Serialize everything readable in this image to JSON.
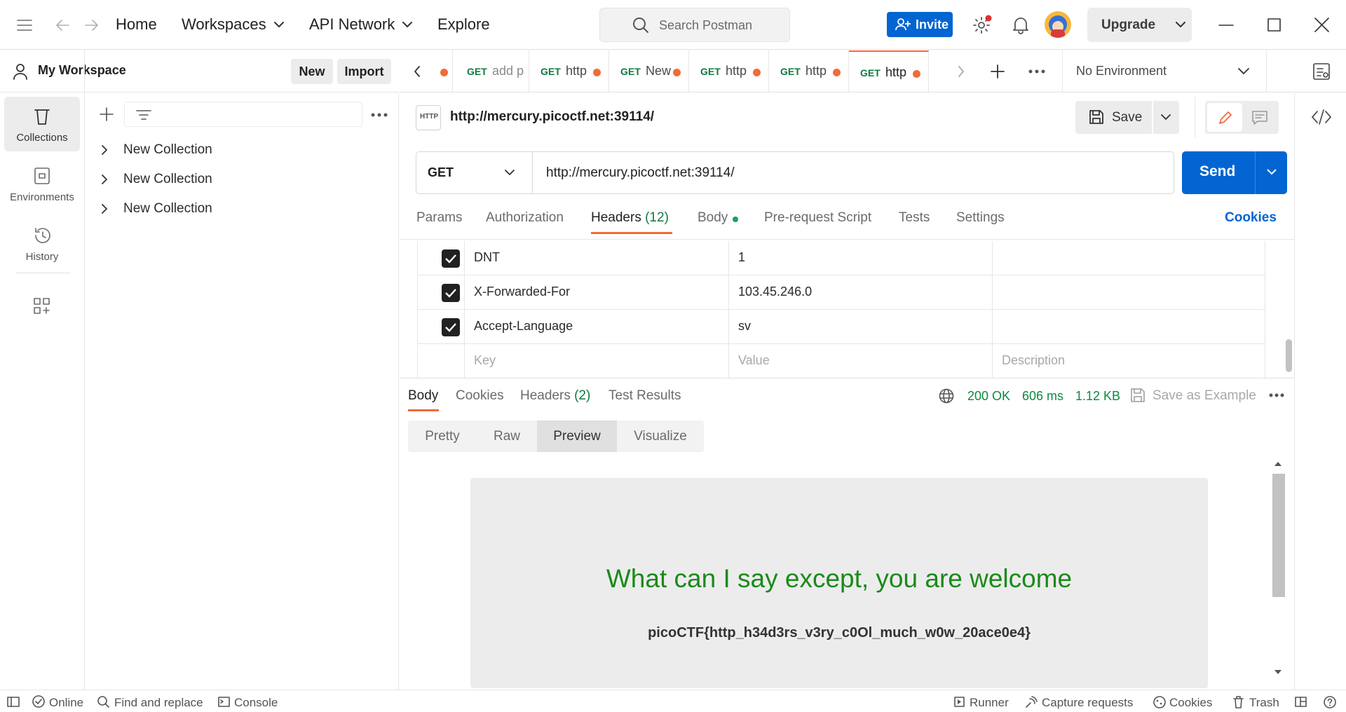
{
  "topbar": {
    "home": "Home",
    "workspaces": "Workspaces",
    "api_network": "API Network",
    "explore": "Explore",
    "search_placeholder": "Search Postman",
    "invite": "Invite",
    "upgrade": "Upgrade"
  },
  "workspace": {
    "name": "My Workspace",
    "new_label": "New",
    "import_label": "Import"
  },
  "rail": {
    "collections": "Collections",
    "environments": "Environments",
    "history": "History"
  },
  "collections": [
    "New Collection",
    "New Collection",
    "New Collection"
  ],
  "tabs": [
    {
      "method": "GET",
      "name": "add pa"
    },
    {
      "method": "GET",
      "name": "http"
    },
    {
      "method": "GET",
      "name": "New"
    },
    {
      "method": "GET",
      "name": "http"
    },
    {
      "method": "GET",
      "name": "http"
    },
    {
      "method": "GET",
      "name": "http"
    }
  ],
  "environment": "No Environment",
  "request": {
    "title": "http://mercury.picoctf.net:39114/",
    "save": "Save",
    "method": "GET",
    "url": "http://mercury.picoctf.net:39114/",
    "send": "Send"
  },
  "request_tabs": {
    "params": "Params",
    "authorization": "Authorization",
    "headers": "Headers",
    "headers_count": "(12)",
    "body": "Body",
    "prerequest": "Pre-request Script",
    "tests": "Tests",
    "settings": "Settings",
    "cookies": "Cookies"
  },
  "headers": [
    {
      "key": "DNT",
      "value": "1"
    },
    {
      "key": "X-Forwarded-For",
      "value": "103.45.246.0"
    },
    {
      "key": "Accept-Language",
      "value": "sv"
    }
  ],
  "headers_placeholder": {
    "key": "Key",
    "value": "Value",
    "description": "Description"
  },
  "response": {
    "tabs": {
      "body": "Body",
      "cookies": "Cookies",
      "headers": "Headers",
      "headers_count": "(2)",
      "test_results": "Test Results"
    },
    "status": "200 OK",
    "time": "606 ms",
    "size": "1.12 KB",
    "save_example": "Save as Example",
    "views": [
      "Pretty",
      "Raw",
      "Preview",
      "Visualize"
    ],
    "active_view": "Preview",
    "preview_heading": "What can I say except, you are welcome",
    "preview_flag": "picoCTF{http_h34d3rs_v3ry_c0Ol_much_w0w_20ace0e4}"
  },
  "statusbar": {
    "online": "Online",
    "find_replace": "Find and replace",
    "console": "Console",
    "runner": "Runner",
    "capture": "Capture requests",
    "cookies": "Cookies",
    "trash": "Trash"
  },
  "colors": {
    "accent_orange": "#f26b3a",
    "primary_blue": "#0265d2",
    "method_green": "#0c7a3f",
    "status_green": "#0c8a3f",
    "preview_green": "#1a8a1a"
  }
}
